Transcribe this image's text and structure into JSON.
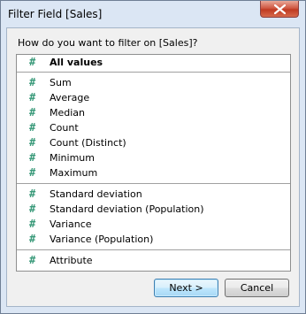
{
  "window": {
    "title": "Filter Field [Sales]",
    "close_icon": "close-icon"
  },
  "prompt": "How do you want to filter on [Sales]?",
  "list": {
    "icon_glyph": "#",
    "items": [
      {
        "label": "All values",
        "bold": true
      },
      {
        "label": "Sum"
      },
      {
        "label": "Average"
      },
      {
        "label": "Median"
      },
      {
        "label": "Count"
      },
      {
        "label": "Count (Distinct)"
      },
      {
        "label": "Minimum"
      },
      {
        "label": "Maximum"
      },
      {
        "label": "Standard deviation"
      },
      {
        "label": "Standard deviation (Population)"
      },
      {
        "label": "Variance"
      },
      {
        "label": "Variance (Population)"
      },
      {
        "label": "Attribute"
      }
    ]
  },
  "buttons": {
    "next": "Next >",
    "cancel": "Cancel"
  },
  "colors": {
    "frame": "#dbe6f4",
    "close_button": "#c94a32",
    "measure_icon": "#3a9a7a"
  }
}
